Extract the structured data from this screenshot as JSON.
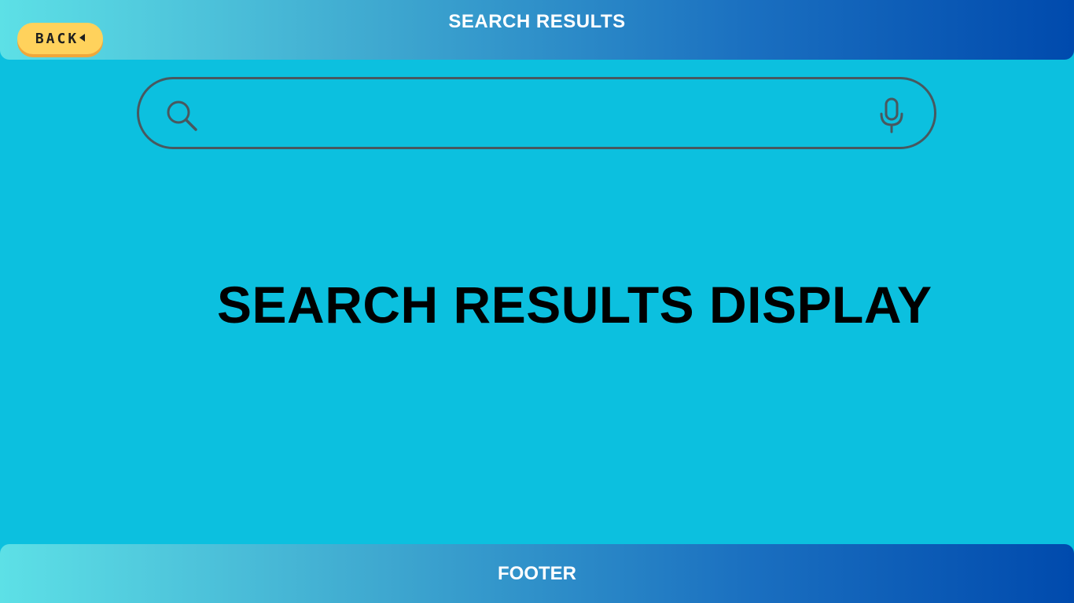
{
  "header": {
    "title": "SEARCH RESULTS",
    "back_label": "BACK"
  },
  "search": {
    "value": "",
    "icon": "search-icon",
    "mic_icon": "microphone-icon"
  },
  "main": {
    "heading": "SEARCH  RESULTS DISPLAY"
  },
  "footer": {
    "label": "FOOTER"
  },
  "colors": {
    "background": "#0cc0df",
    "gradient_start": "#5de0e6",
    "gradient_end": "#004aad",
    "back_button": "#ffd25c",
    "search_border": "#48585f"
  }
}
